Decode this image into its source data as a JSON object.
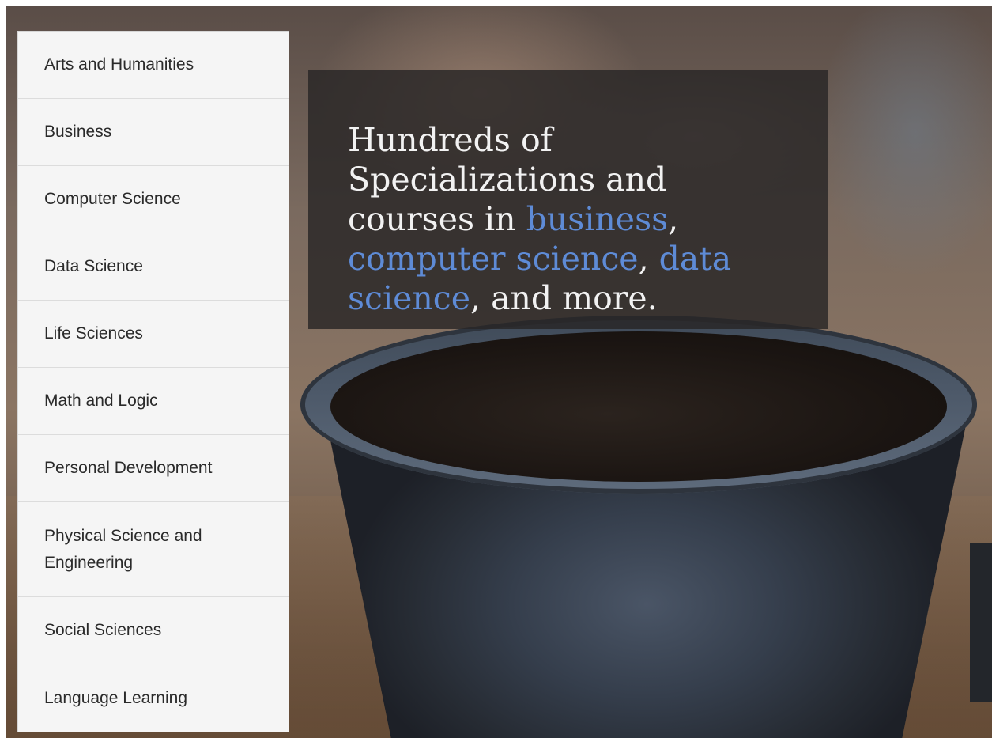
{
  "menu": {
    "items": [
      {
        "label": "Arts and Humanities"
      },
      {
        "label": "Business"
      },
      {
        "label": "Computer Science"
      },
      {
        "label": "Data Science"
      },
      {
        "label": "Life Sciences"
      },
      {
        "label": "Math and Logic"
      },
      {
        "label": "Personal Development"
      },
      {
        "label": "Physical Science and Engineering"
      },
      {
        "label": "Social Sciences"
      },
      {
        "label": "Language Learning"
      }
    ]
  },
  "hero": {
    "text_intro": "Hundreds of Specializations and courses in ",
    "link_business": "business",
    "sep_1": ", ",
    "link_computer_science": "computer science",
    "sep_2": ", ",
    "link_data_science": "data science",
    "text_outro": ", and more.",
    "link_color": "#5e8bd6"
  },
  "background": {
    "image_subject": "ceramic-cup-photo"
  }
}
